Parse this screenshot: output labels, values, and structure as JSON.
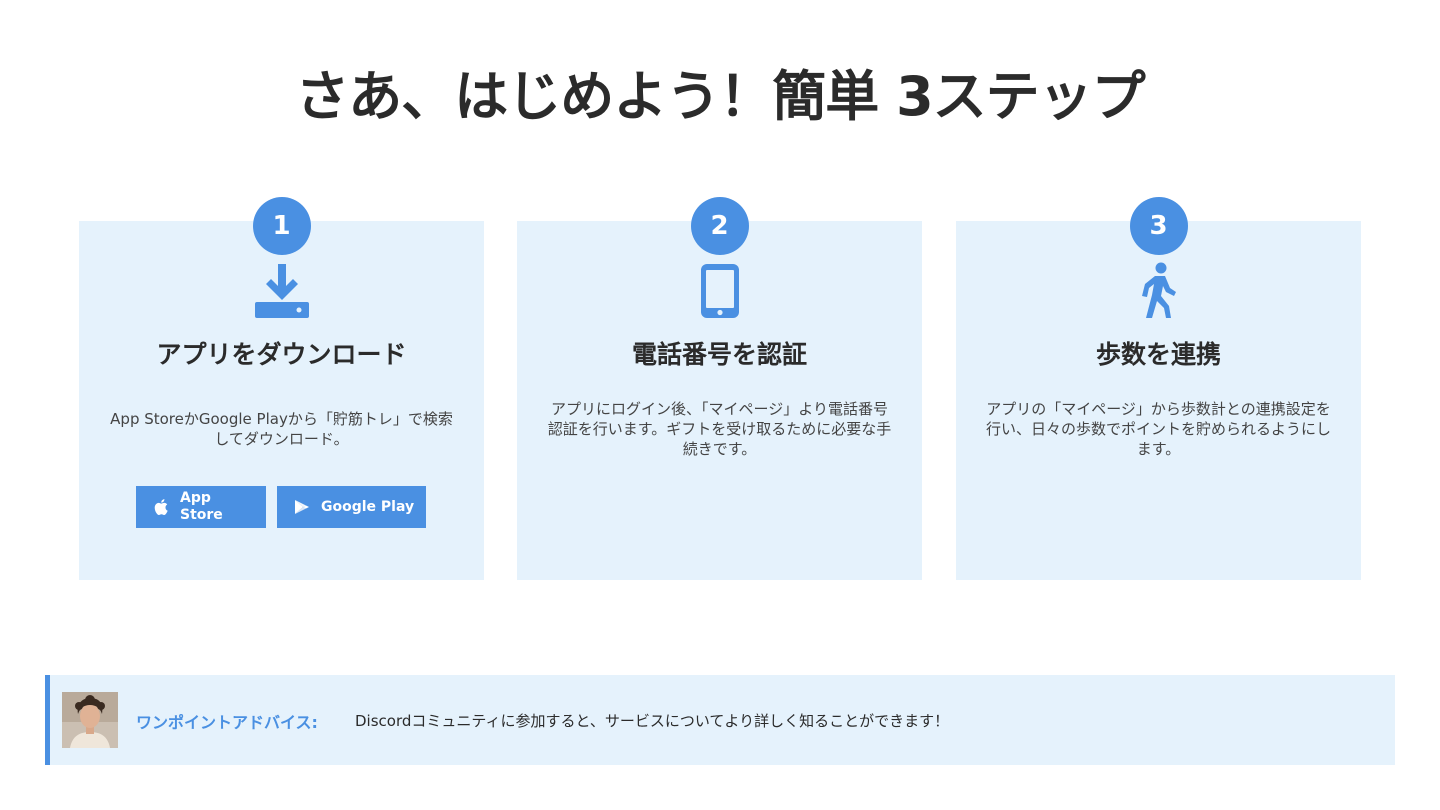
{
  "page": {
    "title": "さあ、はじめよう！簡単 3ステップ"
  },
  "colors": {
    "accent": "#4a90e2",
    "card_background": "#e5f2fc",
    "title_text": "#2b2b2b"
  },
  "steps": [
    {
      "number": "1",
      "icon": "download-icon",
      "title": "アプリをダウンロード",
      "description": "App StoreかGoogle Playから「貯筋トレ」で検索してダウンロード。",
      "buttons": [
        {
          "label": "App Store",
          "icon": "apple-icon"
        },
        {
          "label": "Google Play",
          "icon": "google-play-icon"
        }
      ]
    },
    {
      "number": "2",
      "icon": "smartphone-icon",
      "title": "電話番号を認証",
      "description": "アプリにログイン後、「マイページ」より電話番号認証を行います。ギフトを受け取るために必要な手続きです。"
    },
    {
      "number": "3",
      "icon": "walking-person-icon",
      "title": "歩数を連携",
      "description": "アプリの「マイページ」から歩数計との連携設定を行い、日々の歩数でポイントを貯められるようにします。"
    }
  ],
  "advice": {
    "label": "ワンポイントアドバイス:",
    "text": "Discordコミュニティに参加すると、サービスについてより詳しく知ることができます！"
  }
}
